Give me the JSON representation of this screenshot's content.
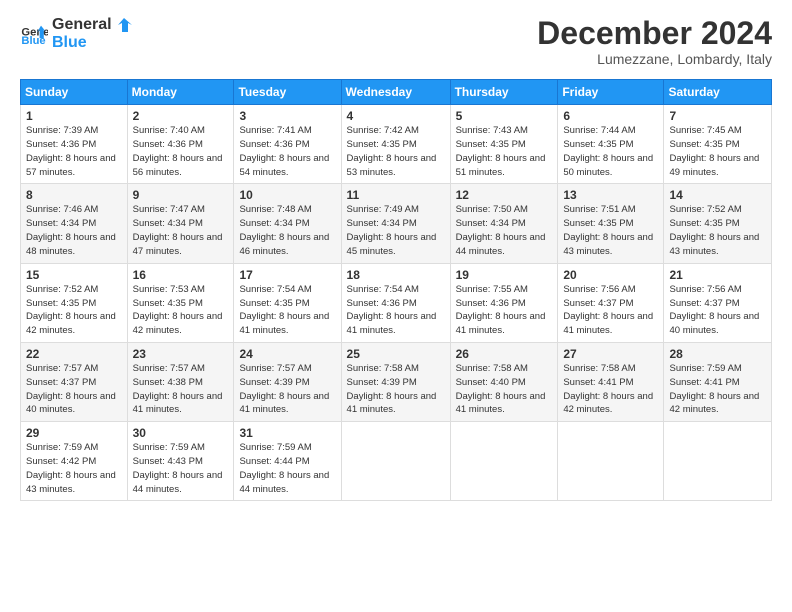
{
  "logo": {
    "line1": "General",
    "line2": "Blue"
  },
  "title": "December 2024",
  "location": "Lumezzane, Lombardy, Italy",
  "days_of_week": [
    "Sunday",
    "Monday",
    "Tuesday",
    "Wednesday",
    "Thursday",
    "Friday",
    "Saturday"
  ],
  "weeks": [
    [
      {
        "day": "1",
        "sunrise": "7:39 AM",
        "sunset": "4:36 PM",
        "daylight": "8 hours and 57 minutes."
      },
      {
        "day": "2",
        "sunrise": "7:40 AM",
        "sunset": "4:36 PM",
        "daylight": "8 hours and 56 minutes."
      },
      {
        "day": "3",
        "sunrise": "7:41 AM",
        "sunset": "4:36 PM",
        "daylight": "8 hours and 54 minutes."
      },
      {
        "day": "4",
        "sunrise": "7:42 AM",
        "sunset": "4:35 PM",
        "daylight": "8 hours and 53 minutes."
      },
      {
        "day": "5",
        "sunrise": "7:43 AM",
        "sunset": "4:35 PM",
        "daylight": "8 hours and 51 minutes."
      },
      {
        "day": "6",
        "sunrise": "7:44 AM",
        "sunset": "4:35 PM",
        "daylight": "8 hours and 50 minutes."
      },
      {
        "day": "7",
        "sunrise": "7:45 AM",
        "sunset": "4:35 PM",
        "daylight": "8 hours and 49 minutes."
      }
    ],
    [
      {
        "day": "8",
        "sunrise": "7:46 AM",
        "sunset": "4:34 PM",
        "daylight": "8 hours and 48 minutes."
      },
      {
        "day": "9",
        "sunrise": "7:47 AM",
        "sunset": "4:34 PM",
        "daylight": "8 hours and 47 minutes."
      },
      {
        "day": "10",
        "sunrise": "7:48 AM",
        "sunset": "4:34 PM",
        "daylight": "8 hours and 46 minutes."
      },
      {
        "day": "11",
        "sunrise": "7:49 AM",
        "sunset": "4:34 PM",
        "daylight": "8 hours and 45 minutes."
      },
      {
        "day": "12",
        "sunrise": "7:50 AM",
        "sunset": "4:34 PM",
        "daylight": "8 hours and 44 minutes."
      },
      {
        "day": "13",
        "sunrise": "7:51 AM",
        "sunset": "4:35 PM",
        "daylight": "8 hours and 43 minutes."
      },
      {
        "day": "14",
        "sunrise": "7:52 AM",
        "sunset": "4:35 PM",
        "daylight": "8 hours and 43 minutes."
      }
    ],
    [
      {
        "day": "15",
        "sunrise": "7:52 AM",
        "sunset": "4:35 PM",
        "daylight": "8 hours and 42 minutes."
      },
      {
        "day": "16",
        "sunrise": "7:53 AM",
        "sunset": "4:35 PM",
        "daylight": "8 hours and 42 minutes."
      },
      {
        "day": "17",
        "sunrise": "7:54 AM",
        "sunset": "4:35 PM",
        "daylight": "8 hours and 41 minutes."
      },
      {
        "day": "18",
        "sunrise": "7:54 AM",
        "sunset": "4:36 PM",
        "daylight": "8 hours and 41 minutes."
      },
      {
        "day": "19",
        "sunrise": "7:55 AM",
        "sunset": "4:36 PM",
        "daylight": "8 hours and 41 minutes."
      },
      {
        "day": "20",
        "sunrise": "7:56 AM",
        "sunset": "4:37 PM",
        "daylight": "8 hours and 41 minutes."
      },
      {
        "day": "21",
        "sunrise": "7:56 AM",
        "sunset": "4:37 PM",
        "daylight": "8 hours and 40 minutes."
      }
    ],
    [
      {
        "day": "22",
        "sunrise": "7:57 AM",
        "sunset": "4:37 PM",
        "daylight": "8 hours and 40 minutes."
      },
      {
        "day": "23",
        "sunrise": "7:57 AM",
        "sunset": "4:38 PM",
        "daylight": "8 hours and 41 minutes."
      },
      {
        "day": "24",
        "sunrise": "7:57 AM",
        "sunset": "4:39 PM",
        "daylight": "8 hours and 41 minutes."
      },
      {
        "day": "25",
        "sunrise": "7:58 AM",
        "sunset": "4:39 PM",
        "daylight": "8 hours and 41 minutes."
      },
      {
        "day": "26",
        "sunrise": "7:58 AM",
        "sunset": "4:40 PM",
        "daylight": "8 hours and 41 minutes."
      },
      {
        "day": "27",
        "sunrise": "7:58 AM",
        "sunset": "4:41 PM",
        "daylight": "8 hours and 42 minutes."
      },
      {
        "day": "28",
        "sunrise": "7:59 AM",
        "sunset": "4:41 PM",
        "daylight": "8 hours and 42 minutes."
      }
    ],
    [
      {
        "day": "29",
        "sunrise": "7:59 AM",
        "sunset": "4:42 PM",
        "daylight": "8 hours and 43 minutes."
      },
      {
        "day": "30",
        "sunrise": "7:59 AM",
        "sunset": "4:43 PM",
        "daylight": "8 hours and 44 minutes."
      },
      {
        "day": "31",
        "sunrise": "7:59 AM",
        "sunset": "4:44 PM",
        "daylight": "8 hours and 44 minutes."
      },
      null,
      null,
      null,
      null
    ]
  ]
}
